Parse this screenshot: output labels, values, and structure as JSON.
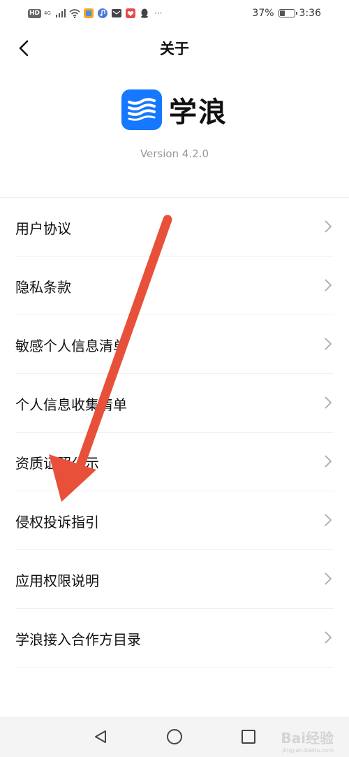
{
  "status_bar": {
    "hd": "HD",
    "network": "4G",
    "battery_text": "37%",
    "battery_level": 0.37,
    "time": "3:36",
    "dots": "···"
  },
  "header": {
    "title": "关于",
    "back_icon": "chevron-left-icon"
  },
  "app": {
    "name": "学浪",
    "version": "Version 4.2.0",
    "brand_color": "#1677ff"
  },
  "menu": {
    "items": [
      {
        "label": "用户协议"
      },
      {
        "label": "隐私条款"
      },
      {
        "label": "敏感个人信息清单"
      },
      {
        "label": "个人信息收集清单"
      },
      {
        "label": "资质证照公示"
      },
      {
        "label": "侵权投诉指引"
      },
      {
        "label": "应用权限说明"
      },
      {
        "label": "学浪接入合作方目录"
      }
    ]
  },
  "nav": {
    "back_icon": "triangle-back-icon",
    "home_icon": "circle-home-icon",
    "recents_icon": "square-recents-icon"
  },
  "annotation": {
    "arrow_color": "#e8503a"
  },
  "watermark": {
    "text": "Bai经验",
    "url": "jingyan.baidu.com"
  }
}
